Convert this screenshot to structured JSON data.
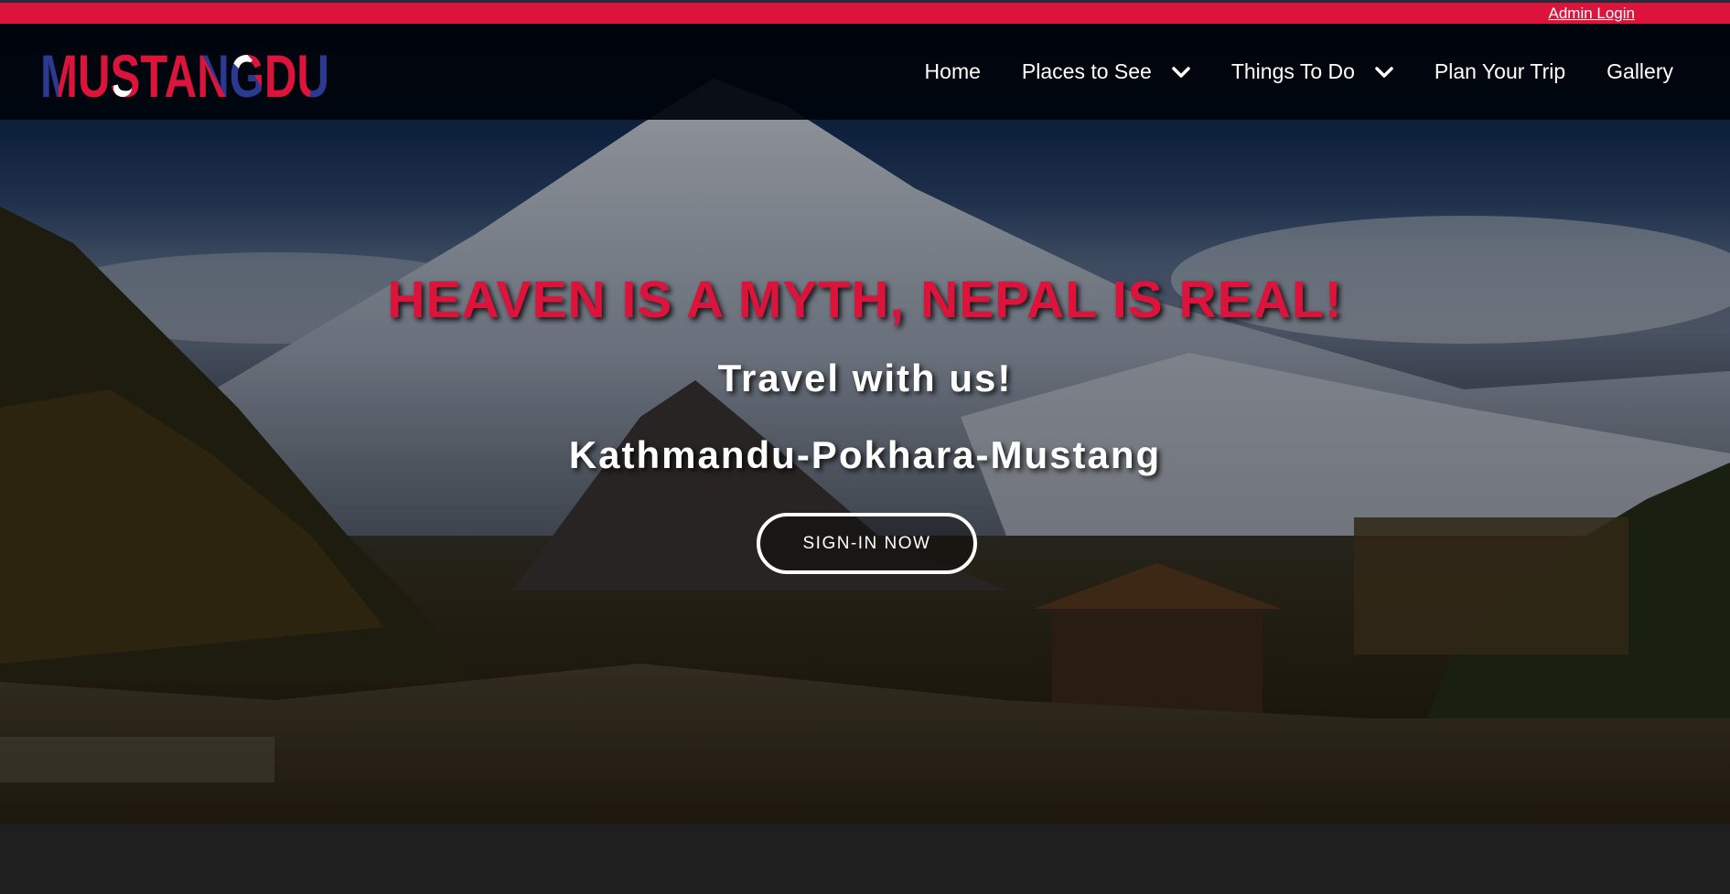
{
  "topbar": {
    "admin_login": "Admin Login"
  },
  "brand": {
    "logo_text": "MUSTANGDU"
  },
  "nav": {
    "items": [
      {
        "label": "Home",
        "has_dropdown": false
      },
      {
        "label": "Places to See",
        "has_dropdown": true
      },
      {
        "label": "Things To Do",
        "has_dropdown": true
      },
      {
        "label": "Plan Your Trip",
        "has_dropdown": false
      },
      {
        "label": "Gallery",
        "has_dropdown": false
      }
    ],
    "dropdown_icon": "chevron-down-icon"
  },
  "hero": {
    "headline": "HEAVEN IS A MYTH, NEPAL IS REAL!",
    "subtitle": "Travel with us!",
    "route": "Kathmandu-Pokhara-Mustang",
    "cta_label": "SIGN-IN NOW"
  },
  "colors": {
    "accent": "#dc143c",
    "nav_bg": "#00040c",
    "text": "#ffffff",
    "footer_bg": "#1f1f1f",
    "logo_blue": "#2b3990"
  }
}
